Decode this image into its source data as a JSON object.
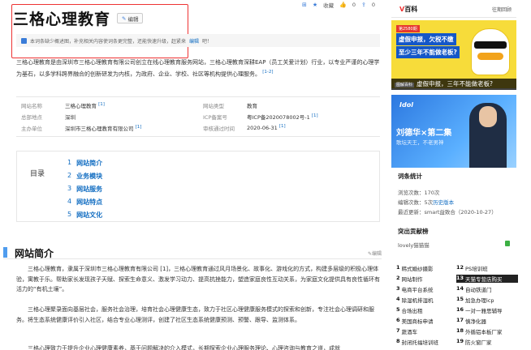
{
  "topbar": {
    "favorite": "收藏",
    "like": "0",
    "share": "0"
  },
  "title": "三格心理教育",
  "edit_label": "编辑",
  "notice": {
    "text": "本词条缺少概述图，补充相关内容使词条更完整，还能快速升级，赶紧来",
    "link": "编辑",
    "suffix": "吧！"
  },
  "summary": "三格心理教育是由深圳市三格心理教育有限公司创立在线心理教育服务网站，三格心理教育深耕EAP（员工关爱计划）行业，以专业严谨的心理学为基石，以多学科跨界融合的创新研发为内核，为政府、企业、学校、社区等机构提供心理服务。",
  "summary_ref": "[1-2]",
  "info": [
    {
      "k1": "网站名称",
      "v1": "三格心理教育",
      "r1": "[1]",
      "k2": "网站类型",
      "v2": "教育",
      "r2": ""
    },
    {
      "k1": "总部地点",
      "v1": "深圳",
      "r1": "",
      "k2": "ICP备案号",
      "v2": "粤ICP备2020078002号-1",
      "r2": "[1]"
    },
    {
      "k1": "主办单位",
      "v1": "深圳市三格心理教育有限公司",
      "r1": "[1]",
      "k2": "审核通过时间",
      "v2": "2020-06-31",
      "r2": "[1]"
    }
  ],
  "toc": {
    "label": "目录",
    "items": [
      {
        "n": "1",
        "label": "网站简介"
      },
      {
        "n": "2",
        "label": "业务模块"
      },
      {
        "n": "3",
        "label": "网站服务"
      },
      {
        "n": "4",
        "label": "网站特点"
      },
      {
        "n": "5",
        "label": "网站文化"
      }
    ]
  },
  "section": {
    "title": "网站简介",
    "edit": "编辑"
  },
  "paras": [
    "三格心理教育，隶属于深圳市三格心理教育有限公司 [1]，三格心理教育通过风月场景化、故事化、游戏化的方式，构建多层级的积极心理体验，寓教于乐。帮助家长发现孩子天赋、探索生命意义、激发学习动力、提高抗挫能力，塑造家庭良性互动关系，为家庭文化提供具有良性循环有活力的“有机土壤”。",
    "三格心理聚录面向基层社会，服务社会治理，培育社会心理健康生态，致力于社区心理健康服务模式的探索和创新，专注社会心理调研和服务。将生态系统健康评价引入社区，结合专业心理测评，创建了社区生态系统健康预测、预警、跟导、监测体系。",
    "三格心理致力于提升企业心理健康素养，基于问题解决的介入模式，长期探索企业心理服务理论、心理咨询与教育之道，成就"
  ],
  "sidebar": {
    "logo_v": "V",
    "logo_text": "百科",
    "link": "往期回顾",
    "ad1": {
      "tag": "第2580期",
      "line1": "虚假申报，欠税不缴",
      "line2": "至少三年不能做老板?",
      "caption_tag": "图解百科",
      "caption": "虚假申报，三年不能做老板?"
    },
    "ad2": {
      "brand": "Idol",
      "name": "刘德华×第二集",
      "slogan": "歌坛天王，不老男神"
    },
    "stats": {
      "title": "词条统计",
      "views_label": "浏览次数：",
      "views": "170次",
      "edits_label": "编辑次数：",
      "edits": "5次",
      "history": "历史版本",
      "updated_label": "最近更新：",
      "updated": "smart益致合（2020-10-27）"
    },
    "contrib": {
      "title": "突出贡献榜",
      "name": "lovely猫猫猫"
    },
    "hot": [
      {
        "n": "1",
        "label": "韩式婚纱摄影"
      },
      {
        "n": "12",
        "label": "PS培训班"
      },
      {
        "n": "2",
        "label": "网站制作"
      },
      {
        "n": "13",
        "label": "天猫专营店购买"
      },
      {
        "n": "3",
        "label": "电商平台系统"
      },
      {
        "n": "14",
        "label": "自动铁道门"
      },
      {
        "n": "4",
        "label": "除湿机排湿机"
      },
      {
        "n": "15",
        "label": "加急办理icp"
      },
      {
        "n": "5",
        "label": "合场出租"
      },
      {
        "n": "16",
        "label": "一对一雅思辅导"
      },
      {
        "n": "6",
        "label": "美国商标申请"
      },
      {
        "n": "17",
        "label": "慎净化器"
      },
      {
        "n": "7",
        "label": "蔬酒车"
      },
      {
        "n": "18",
        "label": "外循铝本板厂家"
      },
      {
        "n": "8",
        "label": "封闭托福培训班"
      },
      {
        "n": "19",
        "label": "防火窗厂家"
      }
    ]
  }
}
